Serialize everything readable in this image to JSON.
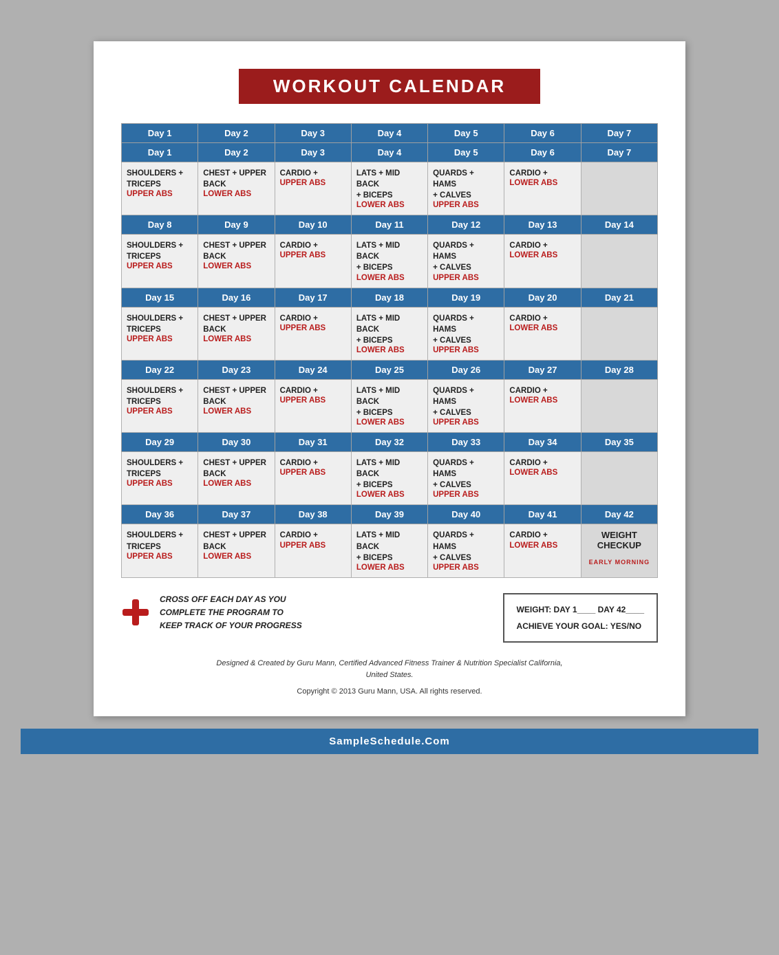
{
  "title": "WORKOUT CALENDAR",
  "weeks": [
    {
      "days": [
        {
          "label": "Day 1",
          "line1": "SHOULDERS +",
          "line2": "TRICEPS",
          "abs": "UPPER ABS"
        },
        {
          "label": "Day 2",
          "line1": "CHEST + UPPER",
          "line2": "BACK",
          "abs": "LOWER ABS"
        },
        {
          "label": "Day 3",
          "line1": "CARDIO +",
          "line2": "",
          "abs": "UPPER ABS",
          "cardio": true
        },
        {
          "label": "Day 4",
          "line1": "LATS + MID BACK",
          "line2": "+ BICEPS",
          "abs": "LOWER ABS"
        },
        {
          "label": "Day 5",
          "line1": "QUARDS + HAMS",
          "line2": "+ CALVES",
          "abs": "UPPER ABS"
        },
        {
          "label": "Day 6",
          "line1": "CARDIO +",
          "line2": "",
          "abs": "LOWER ABS",
          "cardio": true
        },
        {
          "label": "Day 7",
          "empty": true
        }
      ]
    },
    {
      "days": [
        {
          "label": "Day 8",
          "line1": "SHOULDERS +",
          "line2": "TRICEPS",
          "abs": "UPPER ABS"
        },
        {
          "label": "Day 9",
          "line1": "CHEST + UPPER",
          "line2": "BACK",
          "abs": "LOWER ABS"
        },
        {
          "label": "Day 10",
          "line1": "CARDIO +",
          "line2": "",
          "abs": "UPPER ABS",
          "cardio": true
        },
        {
          "label": "Day 11",
          "line1": "LATS + MID BACK",
          "line2": "+ BICEPS",
          "abs": "LOWER ABS"
        },
        {
          "label": "Day 12",
          "line1": "QUARDS + HAMS",
          "line2": "+ CALVES",
          "abs": "UPPER ABS"
        },
        {
          "label": "Day 13",
          "line1": "CARDIO +",
          "line2": "",
          "abs": "LOWER ABS",
          "cardio": true
        },
        {
          "label": "Day 14",
          "empty": true
        }
      ]
    },
    {
      "days": [
        {
          "label": "Day 15",
          "line1": "SHOULDERS +",
          "line2": "TRICEPS",
          "abs": "UPPER ABS"
        },
        {
          "label": "Day 16",
          "line1": "CHEST + UPPER",
          "line2": "BACK",
          "abs": "LOWER ABS"
        },
        {
          "label": "Day 17",
          "line1": "CARDIO +",
          "line2": "",
          "abs": "UPPER ABS",
          "cardio": true
        },
        {
          "label": "Day 18",
          "line1": "LATS + MID BACK",
          "line2": "+ BICEPS",
          "abs": "LOWER ABS"
        },
        {
          "label": "Day 19",
          "line1": "QUARDS + HAMS",
          "line2": "+ CALVES",
          "abs": "UPPER ABS"
        },
        {
          "label": "Day 20",
          "line1": "CARDIO +",
          "line2": "",
          "abs": "LOWER ABS",
          "cardio": true
        },
        {
          "label": "Day 21",
          "empty": true
        }
      ]
    },
    {
      "days": [
        {
          "label": "Day 22",
          "line1": "SHOULDERS +",
          "line2": "TRICEPS",
          "abs": "UPPER ABS"
        },
        {
          "label": "Day 23",
          "line1": "CHEST + UPPER",
          "line2": "BACK",
          "abs": "LOWER ABS"
        },
        {
          "label": "Day 24",
          "line1": "CARDIO +",
          "line2": "",
          "abs": "UPPER ABS",
          "cardio": true
        },
        {
          "label": "Day 25",
          "line1": "LATS + MID BACK",
          "line2": "+ BICEPS",
          "abs": "LOWER ABS"
        },
        {
          "label": "Day 26",
          "line1": "QUARDS + HAMS",
          "line2": "+ CALVES",
          "abs": "UPPER ABS"
        },
        {
          "label": "Day 27",
          "line1": "CARDIO +",
          "line2": "",
          "abs": "LOWER ABS",
          "cardio": true
        },
        {
          "label": "Day 28",
          "empty": true
        }
      ]
    },
    {
      "days": [
        {
          "label": "Day 29",
          "line1": "SHOULDERS +",
          "line2": "TRICEPS",
          "abs": "UPPER ABS"
        },
        {
          "label": "Day 30",
          "line1": "CHEST + UPPER",
          "line2": "BACK",
          "abs": "LOWER ABS"
        },
        {
          "label": "Day 31",
          "line1": "CARDIO +",
          "line2": "",
          "abs": "UPPER ABS",
          "cardio": true
        },
        {
          "label": "Day 32",
          "line1": "LATS + MID BACK",
          "line2": "+ BICEPS",
          "abs": "LOWER ABS"
        },
        {
          "label": "Day 33",
          "line1": "QUARDS + HAMS",
          "line2": "+ CALVES",
          "abs": "UPPER ABS"
        },
        {
          "label": "Day 34",
          "line1": "CARDIO +",
          "line2": "",
          "abs": "LOWER ABS",
          "cardio": true
        },
        {
          "label": "Day 35",
          "empty": true
        }
      ]
    },
    {
      "days": [
        {
          "label": "Day 36",
          "line1": "SHOULDERS +",
          "line2": "TRICEPS",
          "abs": "UPPER ABS"
        },
        {
          "label": "Day 37",
          "line1": "CHEST + UPPER",
          "line2": "BACK",
          "abs": "LOWER ABS"
        },
        {
          "label": "Day 38",
          "line1": "CARDIO +",
          "line2": "",
          "abs": "UPPER ABS",
          "cardio": true
        },
        {
          "label": "Day 39",
          "line1": "LATS + MID BACK",
          "line2": "+ BICEPS",
          "abs": "LOWER ABS"
        },
        {
          "label": "Day 40",
          "line1": "QUARDS + HAMS",
          "line2": "+ CALVES",
          "abs": "UPPER ABS"
        },
        {
          "label": "Day 41",
          "line1": "CARDIO +",
          "line2": "",
          "abs": "LOWER ABS",
          "cardio": true
        },
        {
          "label": "Day 42",
          "special": "weight-checkup",
          "title": "WEIGHT CHECKUP",
          "sub": "EARLY MORNING"
        }
      ]
    }
  ],
  "footer": {
    "cross_text_1": "CROSS OFF EACH DAY AS YOU",
    "cross_text_2": "COMPLETE THE PROGRAM TO",
    "cross_text_3": "KEEP TRACK OF YOUR PROGRESS",
    "weight_label": "WEIGHT:  DAY 1____   DAY 42____",
    "goal_label": "ACHIEVE YOUR GOAL:  YES/NO"
  },
  "credits": "Designed & Created by Guru Mann, Certified Advanced Fitness Trainer & Nutrition Specialist California,",
  "credits2": "United States.",
  "copyright": "Copyright © 2013 Guru Mann, USA. All rights reserved.",
  "site": "SampleSchedule.Com"
}
